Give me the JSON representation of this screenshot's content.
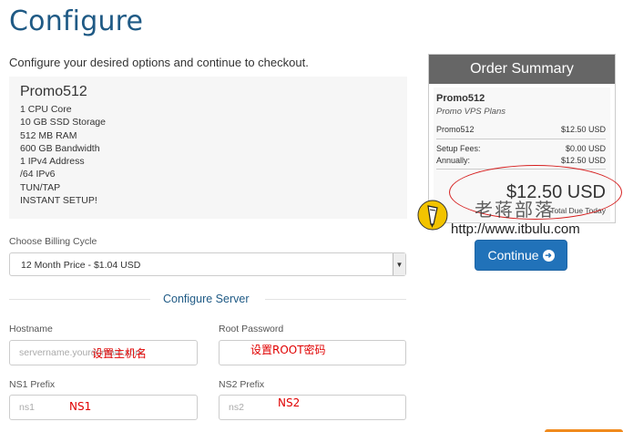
{
  "page": {
    "title": "Configure",
    "subtitle": "Configure your desired options and continue to checkout."
  },
  "product": {
    "name": "Promo512",
    "features": [
      "1 CPU Core",
      "10 GB SSD Storage",
      "512 MB RAM",
      "600 GB Bandwidth",
      "1 IPv4 Address",
      "/64 IPv6",
      "TUN/TAP",
      "INSTANT SETUP!"
    ]
  },
  "billing": {
    "label": "Choose Billing Cycle",
    "selected": "12 Month Price - $1.04 USD"
  },
  "server": {
    "section_title": "Configure Server",
    "hostname_label": "Hostname",
    "hostname_placeholder": "servername.yourdomain.com",
    "root_password_label": "Root Password",
    "ns1_label": "NS1 Prefix",
    "ns1_placeholder": "ns1",
    "ns2_label": "NS2 Prefix",
    "ns2_placeholder": "ns2"
  },
  "annotations": {
    "hostname_note": "设置主机名",
    "password_note": "设置ROOT密码",
    "ns1_note": "NS1",
    "ns2_note": "NS2"
  },
  "order_summary": {
    "header": "Order Summary",
    "product_name": "Promo512",
    "product_group": "Promo VPS Plans",
    "line_item_name": "Promo512",
    "line_item_price": "$12.50 USD",
    "setup_label": "Setup Fees:",
    "setup_value": "$0.00 USD",
    "annually_label": "Annually:",
    "annually_value": "$12.50 USD",
    "total": "$12.50 USD",
    "total_label": "Total Due Today"
  },
  "watermark": {
    "text_cn": "老蒋部落",
    "url": "http://www.itbulu.com"
  },
  "actions": {
    "continue_label": "Continue"
  },
  "colors": {
    "brand_blue": "#1f5a85",
    "button_blue": "#2172b9",
    "annotation_red": "#e00000",
    "header_gray": "#666666"
  }
}
